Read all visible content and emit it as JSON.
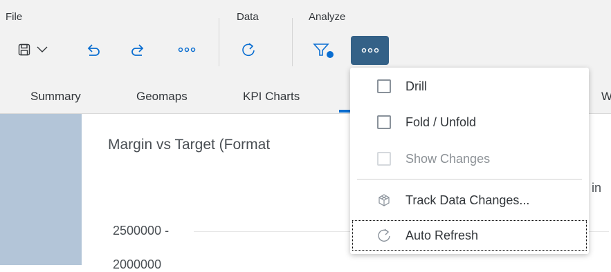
{
  "toolbar": {
    "groups": {
      "file": "File",
      "data": "Data",
      "analyze": "Analyze"
    },
    "icons": {
      "save": "save-icon",
      "save_menu": "chevron-down-icon",
      "undo": "undo-icon",
      "redo": "redo-icon",
      "file_more": "more-icon",
      "refresh": "refresh-icon",
      "filter": "filter-icon",
      "analyze_more": "more-icon"
    },
    "accent_color": "#0a6ed1",
    "active_button_color": "#346187"
  },
  "tabs": [
    {
      "label": "Summary"
    },
    {
      "label": "Geomaps"
    },
    {
      "label": "KPI Charts"
    },
    {
      "label": "W"
    }
  ],
  "chart": {
    "title": "Margin vs Target (Format",
    "legend_fragment": "in",
    "ticks": [
      "2500000 -",
      "2000000"
    ]
  },
  "menu": {
    "items": [
      {
        "label": "Drill",
        "icon": "checkbox-icon",
        "enabled": "true"
      },
      {
        "label": "Fold / Unfold",
        "icon": "checkbox-icon",
        "enabled": "true"
      },
      {
        "label": "Show Changes",
        "icon": "checkbox-icon",
        "enabled": "false"
      },
      {
        "label": "Track Data Changes...",
        "icon": "cube-icon",
        "enabled": "true"
      },
      {
        "label": "Auto Refresh",
        "icon": "refresh-icon",
        "enabled": "true"
      }
    ]
  }
}
